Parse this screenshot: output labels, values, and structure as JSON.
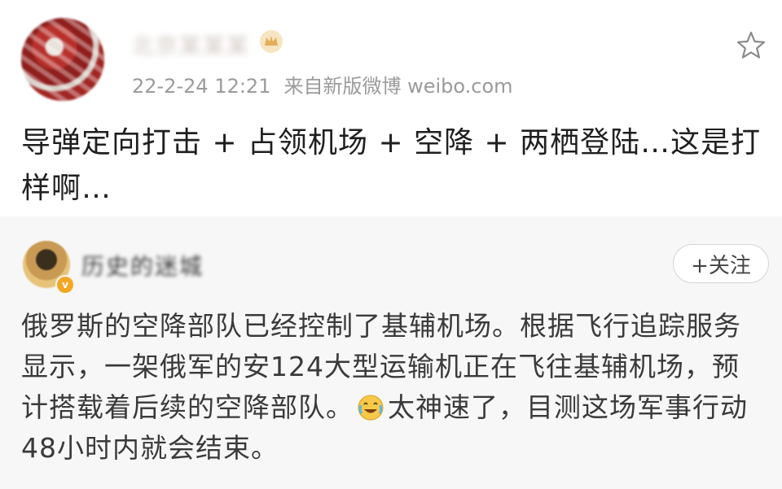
{
  "post": {
    "username": "北京某某某",
    "timestamp": "22-2-24 12:21",
    "source": "来自新版微博 weibo.com",
    "text": "导弹定向打击 + 占领机场 + 空降 + 两栖登陆…这是打样啊…",
    "icons": {
      "avatar": "avatar-image",
      "crown": "crown-icon",
      "favorite": "star-icon"
    }
  },
  "repost": {
    "username": "历史的迷城",
    "follow_label": "+关注",
    "text_part1": "俄罗斯的空降部队已经控制了基辅机场。根据飞行追踪服务显示，一架俄军的安124大型运输机正在飞往基辅机场，预计搭载着后续的空降部队。",
    "text_part2": "太神速了，目测这场军事行动48小时内就会结束。",
    "icons": {
      "emoji": "laugh-cry-emoji-icon",
      "verified": "verified-badge-icon"
    }
  },
  "colors": {
    "text_primary": "#1f1f1f",
    "text_secondary": "#9b9b9b",
    "repost_bg": "#f7f7f7",
    "badge": "#f5a623"
  }
}
